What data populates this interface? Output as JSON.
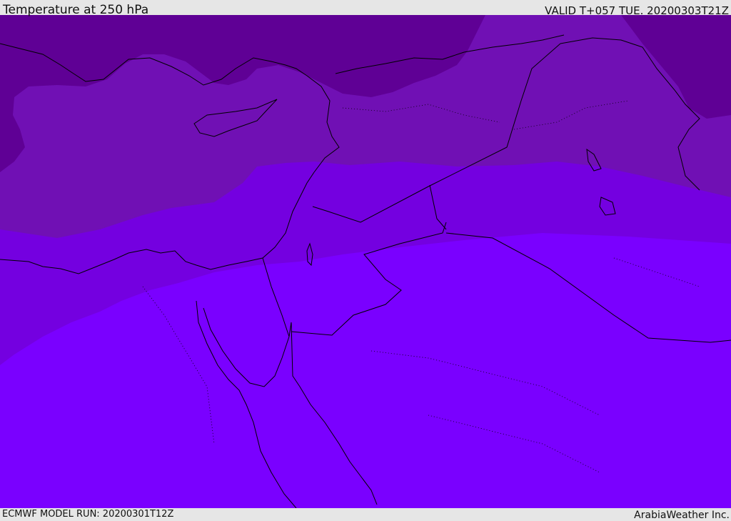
{
  "header": {
    "title": "Temperature at 250 hPa",
    "valid_time": "VALID T+057 TUE. 20200303T21Z"
  },
  "footer": {
    "model_run": "ECMWF MODEL RUN: 20200301T12Z",
    "brand": "ArabiaWeather Inc."
  },
  "map": {
    "region": "Eastern Mediterranean and Middle East",
    "colors": {
      "coldest": "#5f0095",
      "cold": "#7010b4",
      "mid": "#7400e0",
      "warm": "#7a00ff",
      "coastline": "#000000",
      "border": "#000000"
    }
  }
}
